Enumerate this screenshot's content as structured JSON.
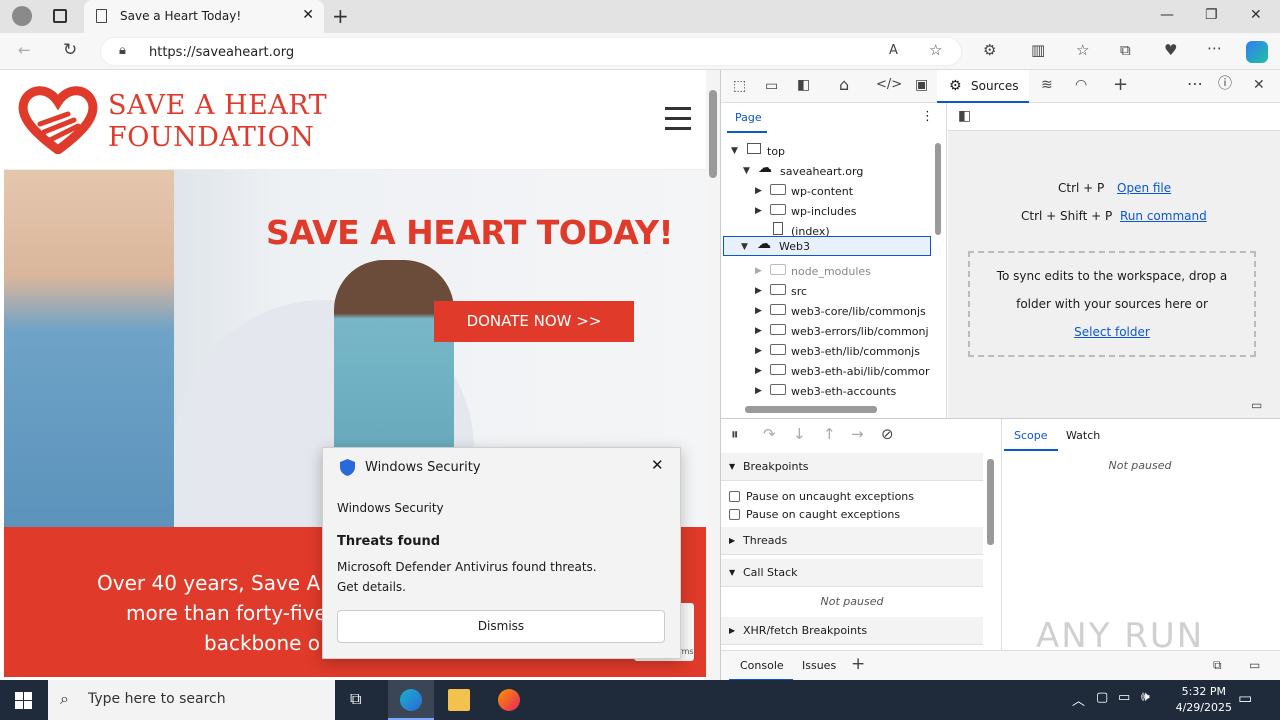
{
  "browser": {
    "tab_title": "Save a Heart Today!",
    "url": "https://saveaheart.org"
  },
  "site": {
    "logo_line1": "SAVE A HEART",
    "logo_line2": "FOUNDATION",
    "hero_title": "SAVE A HEART TODAY!",
    "donate_label": "DONATE NOW >>",
    "band_lines": [
      "Over 40 years, Save A H",
      "more than forty-five",
      "backbone o"
    ],
    "recaptcha_terms": "Terms"
  },
  "notification": {
    "header": "Windows Security",
    "source": "Windows Security",
    "title": "Threats found",
    "message_line1": "Microsoft Defender Antivirus found threats.",
    "message_line2": "Get details.",
    "dismiss_label": "Dismiss"
  },
  "devtools": {
    "active_tab": "Sources",
    "nav_tab": "Page",
    "tree": {
      "top": "top",
      "domain": "saveaheart.org",
      "items1": [
        "wp-content",
        "wp-includes",
        "(index)"
      ],
      "web3": "Web3",
      "items2": [
        "node_modules",
        "src",
        "web3-core/lib/commonjs",
        "web3-errors/lib/commonj",
        "web3-eth/lib/commonjs",
        "web3-eth-abi/lib/commor",
        "web3-eth-accounts"
      ]
    },
    "shortcut1_key": "Ctrl + P",
    "shortcut1_link": "Open file",
    "shortcut2_key": "Ctrl + Shift + P",
    "shortcut2_link": "Run command",
    "drop_text1": "To sync edits to the workspace, drop a",
    "drop_text2": "folder with your sources here or",
    "drop_link": "Select folder",
    "scope_tab": "Scope",
    "watch_tab": "Watch",
    "not_paused": "Not paused",
    "breakpoints": "Breakpoints",
    "pause_uncaught": "Pause on uncaught exceptions",
    "pause_caught": "Pause on caught exceptions",
    "threads": "Threads",
    "call_stack": "Call Stack",
    "call_stack_status": "Not paused",
    "xhr": "XHR/fetch Breakpoints",
    "console_tab": "Console",
    "issues_tab": "Issues"
  },
  "taskbar": {
    "search_placeholder": "Type here to search",
    "time": "5:32 PM",
    "date": "4/29/2025"
  },
  "watermark": "ANY RUN"
}
